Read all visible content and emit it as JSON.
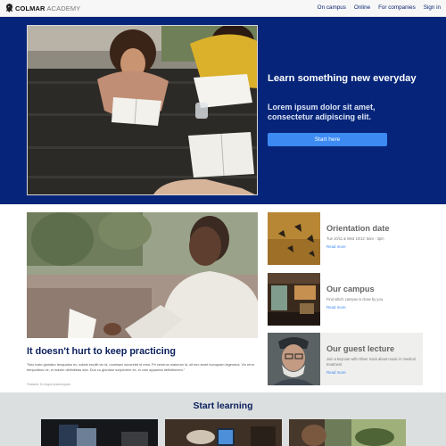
{
  "brand": {
    "bold": "COLMAR",
    "light": "ACADEMY"
  },
  "nav": [
    "On campus",
    "Online",
    "For companies",
    "Sign in"
  ],
  "hero": {
    "title": "Learn something new everyday",
    "subtitle": "Lorem ipsum dolor sit amet, consectetur adipiscing elit.",
    "button": "Start here"
  },
  "feature": {
    "title": "It doesn't hurt to keep practicing",
    "text": "\"Nec iusto gloriatur tenquatos ex, soleat eruditi vix id, nominavi sonsretet id mea. Pri ceneros maiorum id, sit nec amet numquam legendos. Vix error temporibus ne, ei maxim definiebas sea. Duo cu gloriatur scriptorem ex, in cum appareat definitionem.\"",
    "credit": "Featured: Dr Angus Aramburgues"
  },
  "cards": [
    {
      "title": "Orientation date",
      "desc": "Tue 10/11 & Wed 10/12: 8am - 3pm",
      "link": "Read more"
    },
    {
      "title": "Our campus",
      "desc": "Find which campus is close by you.",
      "link": "Read more"
    },
    {
      "title": "Our guest lecture",
      "desc": "Join a keynote with Oliver Sack about music in medical treatment",
      "link": "Read more"
    }
  ],
  "start_learning": {
    "title": "Start learning"
  },
  "colors": {
    "navy": "#06257a",
    "button": "#3c8af2",
    "heading": "#0a1f5c"
  },
  "icons": [
    "lion-logo-icon"
  ]
}
